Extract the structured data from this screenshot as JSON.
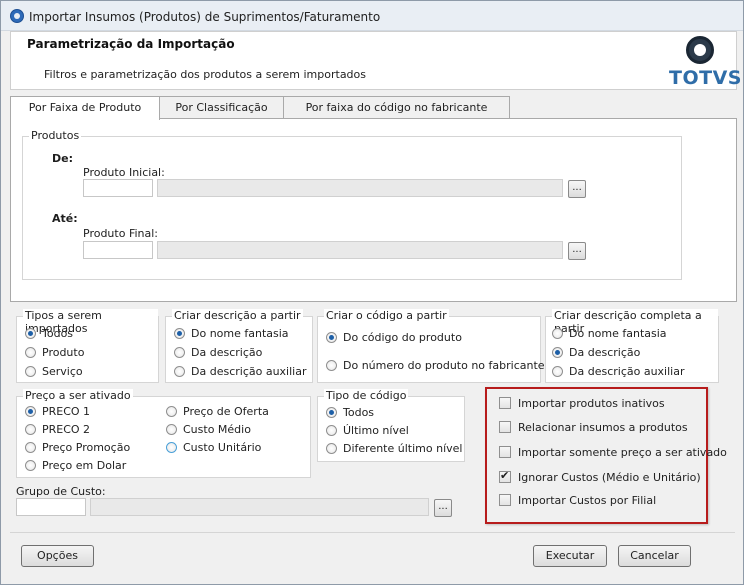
{
  "window": {
    "title": "Importar Insumos (Produtos) de Suprimentos/Faturamento"
  },
  "header": {
    "title": "Parametrização da Importação",
    "subtitle": "Filtros e parametrização dos produtos a serem importados",
    "logo_text": "TOTVS"
  },
  "tabs": [
    {
      "label": "Por Faixa de Produto",
      "active": true
    },
    {
      "label": "Por Classificação",
      "active": false
    },
    {
      "label": "Por faixa do código no fabricante",
      "active": false
    }
  ],
  "produtos": {
    "legend": "Produtos",
    "de_label": "De:",
    "ate_label": "Até:",
    "produto_inicial_label": "Produto Inicial:",
    "produto_final_label": "Produto Final:",
    "lookup_label": "..."
  },
  "tipos": {
    "title": "Tipos a serem importados",
    "options": [
      "Todos",
      "Produto",
      "Serviço"
    ],
    "selected": "Todos"
  },
  "criar_descricao": {
    "title": "Criar descrição a partir",
    "options": [
      "Do nome fantasia",
      "Da descrição",
      "Da descrição auxiliar"
    ],
    "selected": "Do nome fantasia"
  },
  "criar_codigo": {
    "title": "Criar o código a partir",
    "options": [
      "Do código do produto",
      "Do número do produto no fabricante"
    ],
    "selected": "Do código do produto"
  },
  "criar_descricao_completa": {
    "title": "Criar descrição completa a partir",
    "options": [
      "Do nome fantasia",
      "Da descrição",
      "Da descrição auxiliar"
    ],
    "selected": "Da descrição"
  },
  "preco": {
    "title": "Preço a ser ativado",
    "options_left": [
      "PRECO 1",
      "PRECO 2",
      "Preço Promoção",
      "Preço em Dolar"
    ],
    "options_right": [
      "Preço de Oferta",
      "Custo Médio",
      "Custo Unitário"
    ],
    "selected": "PRECO 1"
  },
  "tipo_codigo": {
    "title": "Tipo de código",
    "options": [
      "Todos",
      "Último nível",
      "Diferente último nível"
    ],
    "selected": "Todos"
  },
  "checkboxes": [
    {
      "label": "Importar produtos inativos",
      "checked": false
    },
    {
      "label": "Relacionar insumos a produtos",
      "checked": false
    },
    {
      "label": "Importar somente preço a ser ativado",
      "checked": false
    },
    {
      "label": "Ignorar Custos (Médio e Unitário)",
      "checked": true
    },
    {
      "label": "Importar Custos por Filial",
      "checked": false
    }
  ],
  "grupo_custo": {
    "label": "Grupo de Custo:"
  },
  "buttons": {
    "opcoes": "Opções",
    "executar": "Executar",
    "cancelar": "Cancelar"
  }
}
